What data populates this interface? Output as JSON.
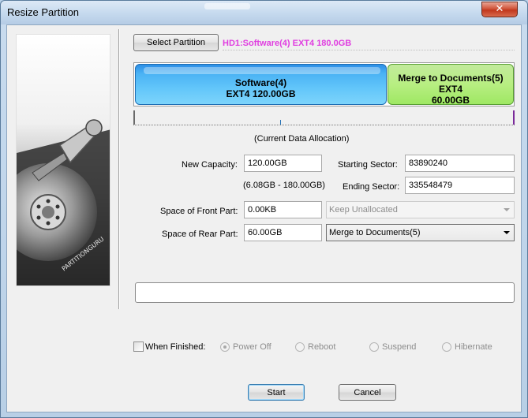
{
  "window": {
    "title": "Resize Partition",
    "close_label": "✕"
  },
  "disk": {
    "select_button": "Select Partition",
    "label": "HD1:Software(4) EXT4 180.0GB",
    "partitions": [
      {
        "name": "Software(4)",
        "detail": "EXT4 120.00GB",
        "color": "#4ab2f4"
      },
      {
        "name": "Merge to Documents(5)",
        "fs": "EXT4",
        "size": "60.00GB",
        "color": "#b8ee82"
      }
    ],
    "allocation_caption": "(Current Data Allocation)"
  },
  "form": {
    "new_capacity_label": "New Capacity:",
    "new_capacity_value": "120.00GB",
    "capacity_range": "(6.08GB - 180.00GB)",
    "starting_sector_label": "Starting Sector:",
    "starting_sector_value": "83890240",
    "ending_sector_label": "Ending Sector:",
    "ending_sector_value": "335548479",
    "front_space_label": "Space of Front Part:",
    "front_space_value": "0.00KB",
    "front_option": "Keep Unallocated",
    "rear_space_label": "Space of Rear Part:",
    "rear_space_value": "60.00GB",
    "rear_option": "Merge to Documents(5)"
  },
  "finish": {
    "checkbox_label": "When Finished:",
    "options": [
      "Power Off",
      "Reboot",
      "Suspend",
      "Hibernate"
    ]
  },
  "actions": {
    "start": "Start",
    "cancel": "Cancel"
  },
  "logo_text": "PARTITIONGURU"
}
